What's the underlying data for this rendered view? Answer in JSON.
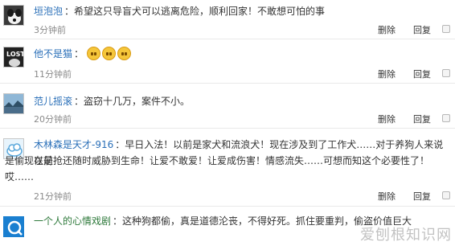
{
  "comments": [
    {
      "username": "垣泡泡",
      "separator": "：",
      "text": "希望这只导盲犬可以逃离危险，顺利回家！不敢想可怕的事",
      "time": "3分钟前",
      "delete_label": "删除",
      "reply_label": "回复"
    },
    {
      "username": "他不是猫",
      "separator": "：",
      "text": "",
      "emoji_count": 3,
      "time": "11分钟前",
      "delete_label": "删除",
      "reply_label": "回复"
    },
    {
      "username": "范儿摇滚",
      "separator": "：",
      "text": "盗窃十几万，案件不小。",
      "time": "20分钟前",
      "delete_label": "删除",
      "reply_label": "回复"
    },
    {
      "username": "木林森是天才-916",
      "separator": "：",
      "text_line1": "早日入法！以前是家犬和流浪犬！现在涉及到了工作犬……对于养狗人来说以前",
      "text_line2": "是偷现在是抢还随时威胁到生命！让爱不敢爱！让爱成伤害！情感流失……可想而知这个必要性了！",
      "text_line3": "哎……",
      "time": "21分钟前",
      "delete_label": "删除",
      "reply_label": "回复"
    },
    {
      "username": "一个人的心情戏剧",
      "separator": "：",
      "text": "这种狗都偷，真是道德沦丧，不得好死。抓住要重判，偷盗价值巨大"
    }
  ],
  "avatar_lost_text": "LOST",
  "watermark": "爱刨根知识网"
}
